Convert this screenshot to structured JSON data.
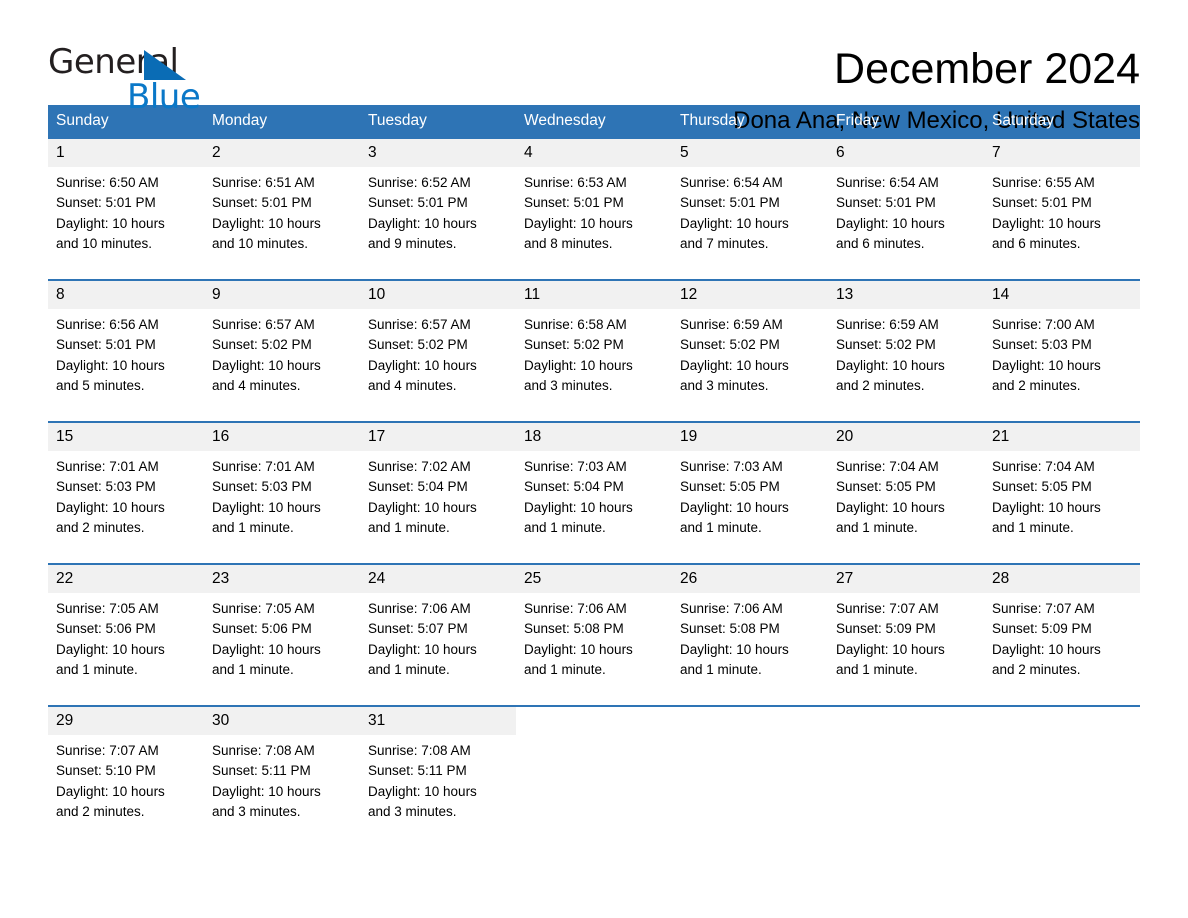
{
  "brand": {
    "name_part1": "General",
    "name_part2": "Blue",
    "accent_color": "#0a78c8",
    "triangle_color": "#0a6cb5"
  },
  "header": {
    "month_title": "December 2024",
    "location": "Dona Ana, New Mexico, United States",
    "header_bg_color": "#2e74b5",
    "daynum_bg_color": "#f1f1f1"
  },
  "calendar": {
    "weekday_headers": [
      "Sunday",
      "Monday",
      "Tuesday",
      "Wednesday",
      "Thursday",
      "Friday",
      "Saturday"
    ],
    "weeks": [
      [
        {
          "day": "1",
          "sunrise": "Sunrise: 6:50 AM",
          "sunset": "Sunset: 5:01 PM",
          "daylight_1": "Daylight: 10 hours",
          "daylight_2": "and 10 minutes."
        },
        {
          "day": "2",
          "sunrise": "Sunrise: 6:51 AM",
          "sunset": "Sunset: 5:01 PM",
          "daylight_1": "Daylight: 10 hours",
          "daylight_2": "and 10 minutes."
        },
        {
          "day": "3",
          "sunrise": "Sunrise: 6:52 AM",
          "sunset": "Sunset: 5:01 PM",
          "daylight_1": "Daylight: 10 hours",
          "daylight_2": "and 9 minutes."
        },
        {
          "day": "4",
          "sunrise": "Sunrise: 6:53 AM",
          "sunset": "Sunset: 5:01 PM",
          "daylight_1": "Daylight: 10 hours",
          "daylight_2": "and 8 minutes."
        },
        {
          "day": "5",
          "sunrise": "Sunrise: 6:54 AM",
          "sunset": "Sunset: 5:01 PM",
          "daylight_1": "Daylight: 10 hours",
          "daylight_2": "and 7 minutes."
        },
        {
          "day": "6",
          "sunrise": "Sunrise: 6:54 AM",
          "sunset": "Sunset: 5:01 PM",
          "daylight_1": "Daylight: 10 hours",
          "daylight_2": "and 6 minutes."
        },
        {
          "day": "7",
          "sunrise": "Sunrise: 6:55 AM",
          "sunset": "Sunset: 5:01 PM",
          "daylight_1": "Daylight: 10 hours",
          "daylight_2": "and 6 minutes."
        }
      ],
      [
        {
          "day": "8",
          "sunrise": "Sunrise: 6:56 AM",
          "sunset": "Sunset: 5:01 PM",
          "daylight_1": "Daylight: 10 hours",
          "daylight_2": "and 5 minutes."
        },
        {
          "day": "9",
          "sunrise": "Sunrise: 6:57 AM",
          "sunset": "Sunset: 5:02 PM",
          "daylight_1": "Daylight: 10 hours",
          "daylight_2": "and 4 minutes."
        },
        {
          "day": "10",
          "sunrise": "Sunrise: 6:57 AM",
          "sunset": "Sunset: 5:02 PM",
          "daylight_1": "Daylight: 10 hours",
          "daylight_2": "and 4 minutes."
        },
        {
          "day": "11",
          "sunrise": "Sunrise: 6:58 AM",
          "sunset": "Sunset: 5:02 PM",
          "daylight_1": "Daylight: 10 hours",
          "daylight_2": "and 3 minutes."
        },
        {
          "day": "12",
          "sunrise": "Sunrise: 6:59 AM",
          "sunset": "Sunset: 5:02 PM",
          "daylight_1": "Daylight: 10 hours",
          "daylight_2": "and 3 minutes."
        },
        {
          "day": "13",
          "sunrise": "Sunrise: 6:59 AM",
          "sunset": "Sunset: 5:02 PM",
          "daylight_1": "Daylight: 10 hours",
          "daylight_2": "and 2 minutes."
        },
        {
          "day": "14",
          "sunrise": "Sunrise: 7:00 AM",
          "sunset": "Sunset: 5:03 PM",
          "daylight_1": "Daylight: 10 hours",
          "daylight_2": "and 2 minutes."
        }
      ],
      [
        {
          "day": "15",
          "sunrise": "Sunrise: 7:01 AM",
          "sunset": "Sunset: 5:03 PM",
          "daylight_1": "Daylight: 10 hours",
          "daylight_2": "and 2 minutes."
        },
        {
          "day": "16",
          "sunrise": "Sunrise: 7:01 AM",
          "sunset": "Sunset: 5:03 PM",
          "daylight_1": "Daylight: 10 hours",
          "daylight_2": "and 1 minute."
        },
        {
          "day": "17",
          "sunrise": "Sunrise: 7:02 AM",
          "sunset": "Sunset: 5:04 PM",
          "daylight_1": "Daylight: 10 hours",
          "daylight_2": "and 1 minute."
        },
        {
          "day": "18",
          "sunrise": "Sunrise: 7:03 AM",
          "sunset": "Sunset: 5:04 PM",
          "daylight_1": "Daylight: 10 hours",
          "daylight_2": "and 1 minute."
        },
        {
          "day": "19",
          "sunrise": "Sunrise: 7:03 AM",
          "sunset": "Sunset: 5:05 PM",
          "daylight_1": "Daylight: 10 hours",
          "daylight_2": "and 1 minute."
        },
        {
          "day": "20",
          "sunrise": "Sunrise: 7:04 AM",
          "sunset": "Sunset: 5:05 PM",
          "daylight_1": "Daylight: 10 hours",
          "daylight_2": "and 1 minute."
        },
        {
          "day": "21",
          "sunrise": "Sunrise: 7:04 AM",
          "sunset": "Sunset: 5:05 PM",
          "daylight_1": "Daylight: 10 hours",
          "daylight_2": "and 1 minute."
        }
      ],
      [
        {
          "day": "22",
          "sunrise": "Sunrise: 7:05 AM",
          "sunset": "Sunset: 5:06 PM",
          "daylight_1": "Daylight: 10 hours",
          "daylight_2": "and 1 minute."
        },
        {
          "day": "23",
          "sunrise": "Sunrise: 7:05 AM",
          "sunset": "Sunset: 5:06 PM",
          "daylight_1": "Daylight: 10 hours",
          "daylight_2": "and 1 minute."
        },
        {
          "day": "24",
          "sunrise": "Sunrise: 7:06 AM",
          "sunset": "Sunset: 5:07 PM",
          "daylight_1": "Daylight: 10 hours",
          "daylight_2": "and 1 minute."
        },
        {
          "day": "25",
          "sunrise": "Sunrise: 7:06 AM",
          "sunset": "Sunset: 5:08 PM",
          "daylight_1": "Daylight: 10 hours",
          "daylight_2": "and 1 minute."
        },
        {
          "day": "26",
          "sunrise": "Sunrise: 7:06 AM",
          "sunset": "Sunset: 5:08 PM",
          "daylight_1": "Daylight: 10 hours",
          "daylight_2": "and 1 minute."
        },
        {
          "day": "27",
          "sunrise": "Sunrise: 7:07 AM",
          "sunset": "Sunset: 5:09 PM",
          "daylight_1": "Daylight: 10 hours",
          "daylight_2": "and 1 minute."
        },
        {
          "day": "28",
          "sunrise": "Sunrise: 7:07 AM",
          "sunset": "Sunset: 5:09 PM",
          "daylight_1": "Daylight: 10 hours",
          "daylight_2": "and 2 minutes."
        }
      ],
      [
        {
          "day": "29",
          "sunrise": "Sunrise: 7:07 AM",
          "sunset": "Sunset: 5:10 PM",
          "daylight_1": "Daylight: 10 hours",
          "daylight_2": "and 2 minutes."
        },
        {
          "day": "30",
          "sunrise": "Sunrise: 7:08 AM",
          "sunset": "Sunset: 5:11 PM",
          "daylight_1": "Daylight: 10 hours",
          "daylight_2": "and 3 minutes."
        },
        {
          "day": "31",
          "sunrise": "Sunrise: 7:08 AM",
          "sunset": "Sunset: 5:11 PM",
          "daylight_1": "Daylight: 10 hours",
          "daylight_2": "and 3 minutes."
        },
        null,
        null,
        null,
        null
      ]
    ]
  }
}
